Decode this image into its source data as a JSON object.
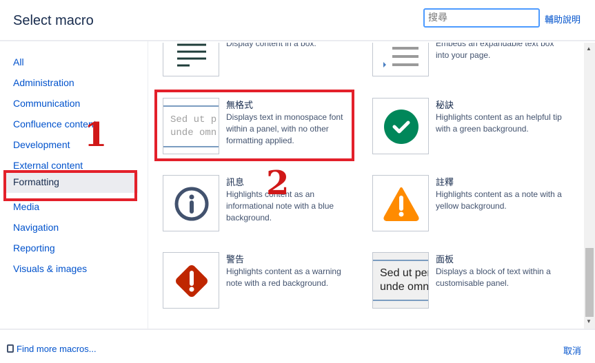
{
  "header": {
    "title": "Select macro",
    "search_placeholder": "搜尋",
    "help": "輔助說明"
  },
  "sidebar": {
    "items": [
      {
        "label": "All"
      },
      {
        "label": "Administration"
      },
      {
        "label": "Communication"
      },
      {
        "label": "Confluence content"
      },
      {
        "label": "Development"
      },
      {
        "label": "External content"
      },
      {
        "label": "Formatting",
        "selected": true
      },
      {
        "label": "Media"
      },
      {
        "label": "Navigation"
      },
      {
        "label": "Reporting"
      },
      {
        "label": "Visuals & images"
      }
    ]
  },
  "macros": [
    {
      "title": "",
      "desc": "Display content in a box.",
      "icon": "lines-icon"
    },
    {
      "title": "",
      "desc": "Embeds an expandable text box into your page.",
      "icon": "expand-icon"
    },
    {
      "title": "無格式",
      "desc": "Displays text in monospace font within a panel, with no other formatting applied.",
      "icon": "noformat-preview",
      "preview": [
        "Sed ut p",
        "unde omn"
      ]
    },
    {
      "title": "秘訣",
      "desc": "Highlights content as an helpful tip with a green background.",
      "icon": "check-circle-icon"
    },
    {
      "title": "訊息",
      "desc": "Highlights content as an informational note with a blue background.",
      "icon": "info-icon"
    },
    {
      "title": "註釋",
      "desc": "Highlights content as a note with a yellow background.",
      "icon": "warning-triangle-icon"
    },
    {
      "title": "警告",
      "desc": "Highlights content as a warning note with a red background.",
      "icon": "error-diamond-icon"
    },
    {
      "title": "面板",
      "desc": "Displays a block of text within a customisable panel.",
      "icon": "panel-preview",
      "preview": [
        "Sed ut per",
        "unde omn"
      ]
    }
  ],
  "footer": {
    "find_more": "Find more macros...",
    "cancel": "取消"
  },
  "annotations": {
    "one": "1",
    "two": "2"
  },
  "colors": {
    "accent": "#0052cc",
    "annotation": "#e3202a",
    "tip": "#00875a",
    "info": "#42526e",
    "note": "#ff8b00",
    "warning": "#bf2600"
  }
}
